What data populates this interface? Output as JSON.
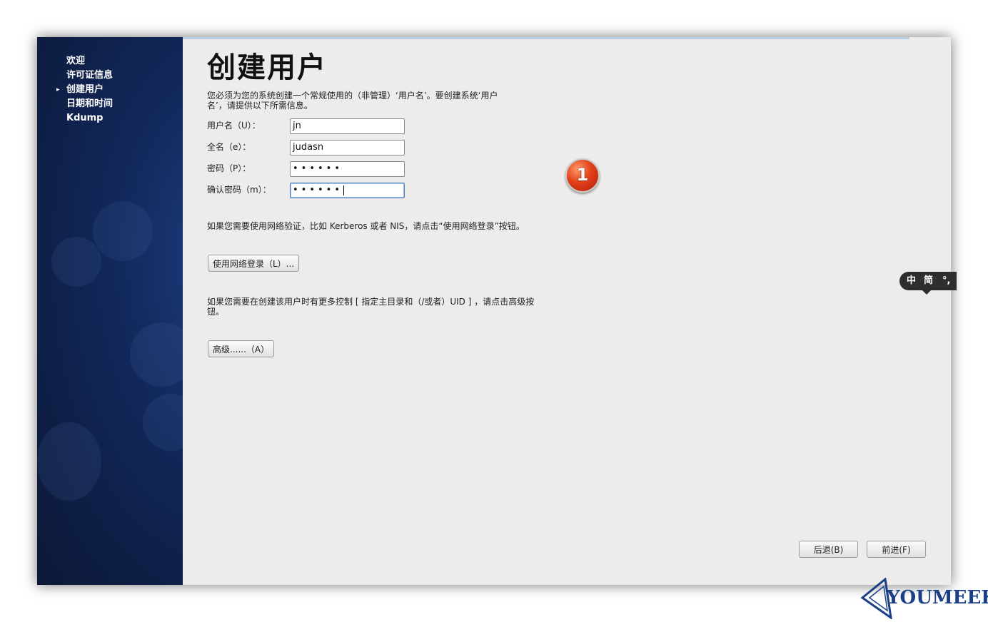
{
  "sidebar": {
    "items": [
      {
        "label": "欢迎",
        "active": false
      },
      {
        "label": "许可证信息",
        "active": false
      },
      {
        "label": "创建用户",
        "active": true
      },
      {
        "label": "日期和时间",
        "active": false
      },
      {
        "label": "Kdump",
        "active": false
      }
    ],
    "active_marker": "▸"
  },
  "main": {
    "title": "创建用户",
    "intro_line1": "您必须为您的系统创建一个常规使用的（非管理）‘用户名’。要创建系统‘用户",
    "intro_line2": "名’，请提供以下所需信息。",
    "form": {
      "username_label": "用户名（U）：",
      "username_value": "jn",
      "fullname_label": "全名（e）：",
      "fullname_value": "judasn",
      "password_label": "密码（P）：",
      "password_value": "••••••",
      "confirm_label": "确认密码（m）：",
      "confirm_value": "••••••"
    },
    "annotation_badge": "1",
    "network_text": "如果您需要使用网络验证，比如 Kerberos 或者 NIS，请点击“使用网络登录”按钮。",
    "network_button": "使用网络登录（L）...",
    "advanced_text_line1": "如果您需要在创建该用户时有更多控制 [ 指定主目录和（/或者）UID ] ，请点击高级按",
    "advanced_text_line2": "钮。",
    "advanced_button": "高级......（A）"
  },
  "footer": {
    "back_button": "后退(B)",
    "forward_button": "前进(F)"
  },
  "ime_bar": {
    "mode": "中",
    "variant": "简",
    "punct": "°,"
  },
  "watermark": {
    "text": "YOUMEEK",
    "color": "#1b3f86"
  },
  "colors": {
    "sidebar_bg": "#12285a",
    "content_bg": "#edecea",
    "badge": "#e2401a"
  }
}
